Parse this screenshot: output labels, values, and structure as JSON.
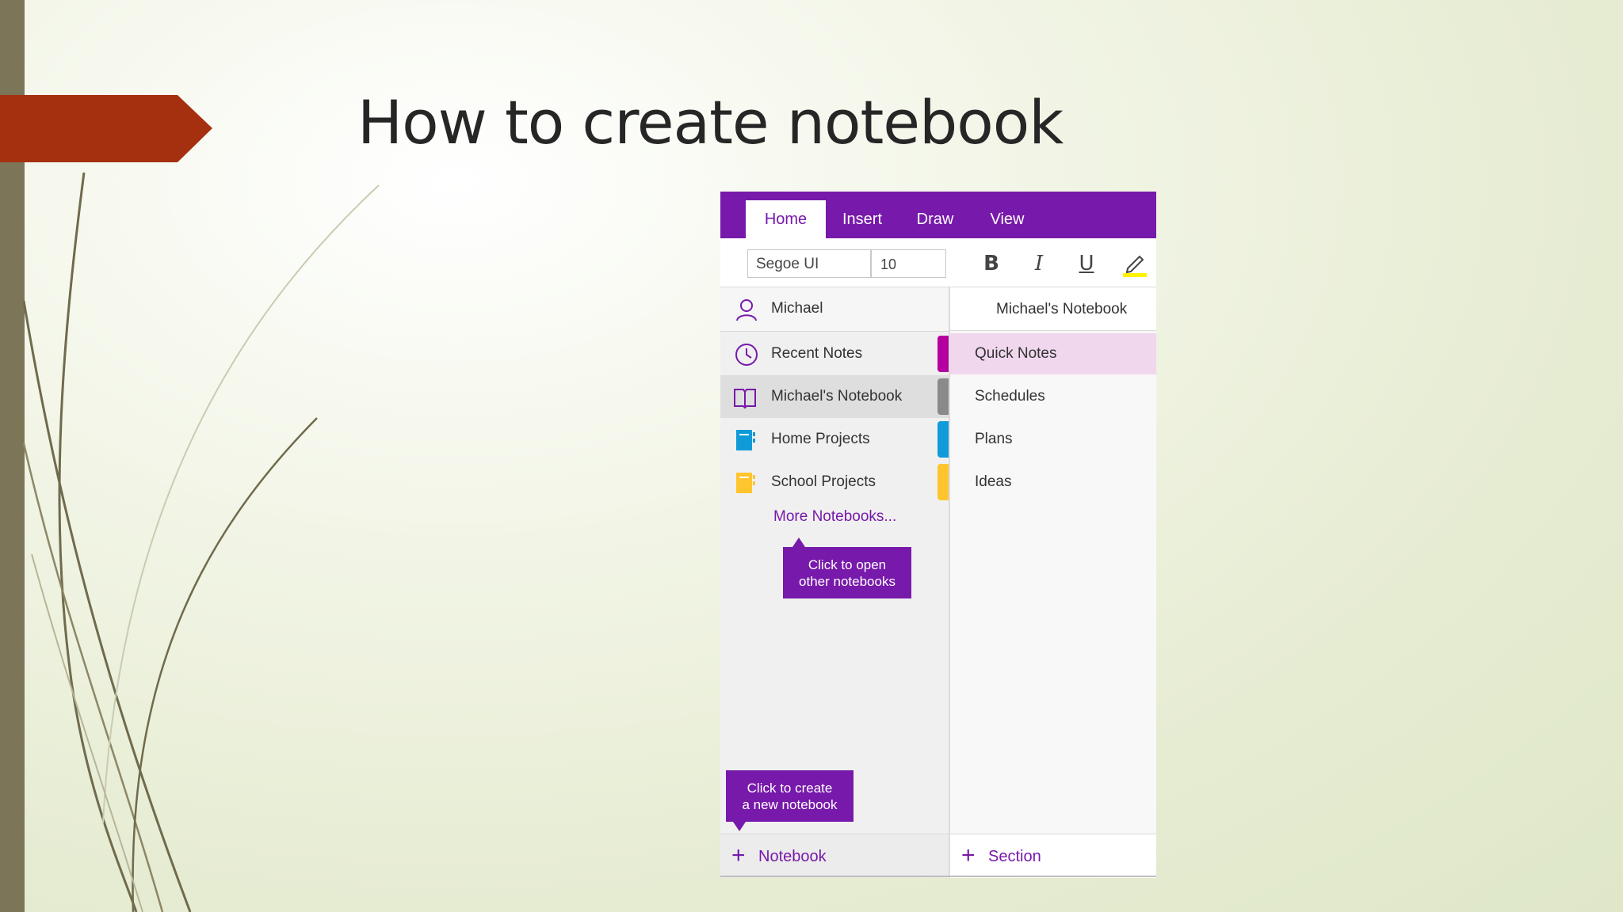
{
  "slide": {
    "title": "How to create notebook"
  },
  "ribbon": {
    "tabs": [
      {
        "label": "Home",
        "active": true
      },
      {
        "label": "Insert",
        "active": false
      },
      {
        "label": "Draw",
        "active": false
      },
      {
        "label": "View",
        "active": false
      }
    ],
    "accent_color": "#7719aa"
  },
  "toolbar": {
    "font_family_value": "Segoe UI",
    "font_size_value": "10",
    "bold_label": "B",
    "italic_label": "I",
    "underline_label": "U",
    "highlight_icon": "highlighter-icon",
    "highlight_color": "#fff200"
  },
  "nav": {
    "user_name": "Michael",
    "items": [
      {
        "label": "Recent Notes",
        "icon": "clock-icon"
      },
      {
        "label": "Michael's Notebook",
        "icon": "open-book-icon",
        "selected": true,
        "color": "#8a8a8a"
      },
      {
        "label": "Home Projects",
        "icon": "notebook-icon",
        "color": "#0f9bd7"
      },
      {
        "label": "School Projects",
        "icon": "notebook-icon",
        "color": "#ffc52f"
      }
    ],
    "more_notebooks": "More Notebooks...",
    "recent_tab_color": "#b4009e",
    "add_notebook_label": "Notebook"
  },
  "callouts": {
    "open_line1": "Click to open",
    "open_line2": "other notebooks",
    "create_line1": "Click to create",
    "create_line2": "a new notebook"
  },
  "sections": {
    "notebook_title": "Michael's Notebook",
    "items": [
      {
        "label": "Quick Notes",
        "active": true
      },
      {
        "label": "Schedules"
      },
      {
        "label": "Plans"
      },
      {
        "label": "Ideas"
      }
    ],
    "add_section_label": "Section"
  }
}
